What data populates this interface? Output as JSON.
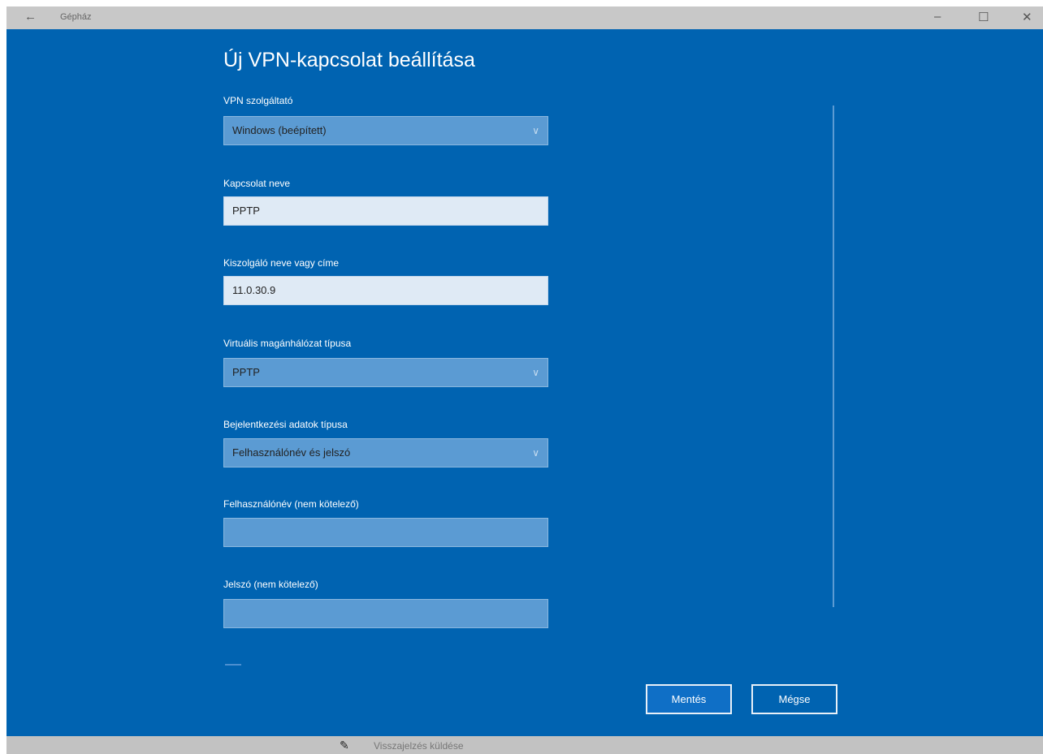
{
  "window": {
    "title": "Gépház",
    "back_glyph": "←",
    "minimize_glyph": "–",
    "maximize_glyph": "☐",
    "close_glyph": "✕"
  },
  "page": {
    "heading": "Új VPN-kapcsolat beállítása"
  },
  "form": {
    "provider": {
      "label": "VPN szolgáltató",
      "value": "Windows (beépített)"
    },
    "connection_name": {
      "label": "Kapcsolat neve",
      "value": "PPTP"
    },
    "server": {
      "label": "Kiszolgáló neve vagy címe",
      "value": "11.0.30.9"
    },
    "vpn_type": {
      "label": "Virtuális magánhálózat típusa",
      "value": "PPTP"
    },
    "signin_type": {
      "label": "Bejelentkezési adatok típusa",
      "value": "Felhasználónév és jelszó"
    },
    "username": {
      "label": "Felhasználónév (nem kötelező)",
      "value": ""
    },
    "password": {
      "label": "Jelszó (nem kötelező)",
      "value": ""
    }
  },
  "buttons": {
    "save": "Mentés",
    "cancel": "Mégse"
  },
  "footer": {
    "feedback_label": "Visszajelzés küldése"
  },
  "icons": {
    "dropdown": "chevron-down-icon",
    "feedback": "feedback-icon"
  },
  "colors": {
    "background": "#0063b1",
    "field": "#5b9bd3",
    "textbox": "#dfeaf5"
  }
}
